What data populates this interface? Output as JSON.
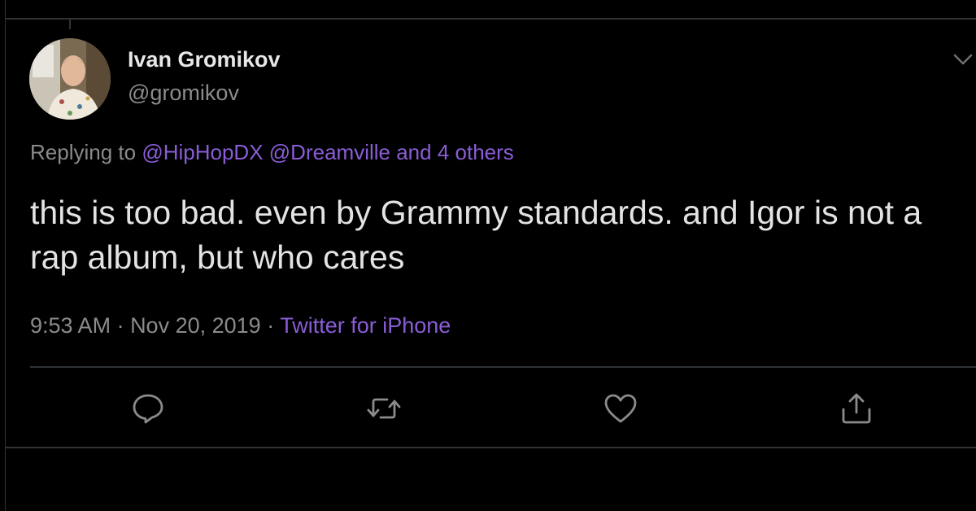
{
  "tweet": {
    "author": {
      "display_name": "Ivan Gromikov",
      "handle": "@gromikov"
    },
    "replying": {
      "prefix": "Replying to ",
      "mention_1": "@HipHopDX",
      "mention_2": "@Dreamville",
      "others": "and 4 others"
    },
    "text": "this is too bad. even by Grammy standards. and Igor is not a rap album, but who cares",
    "time": "9:53 AM",
    "separator": " · ",
    "date": "Nov 20, 2019",
    "source": "Twitter for iPhone"
  },
  "actions": {
    "reply_icon": "speech-bubble",
    "retweet_icon": "retweet-arrows",
    "like_icon": "heart",
    "share_icon": "share-arrow-up"
  },
  "colors": {
    "background": "#000000",
    "text": "#e3e3e3",
    "muted": "#8b8b8b",
    "accent": "#8a5dd6",
    "divider": "#2f3336"
  }
}
